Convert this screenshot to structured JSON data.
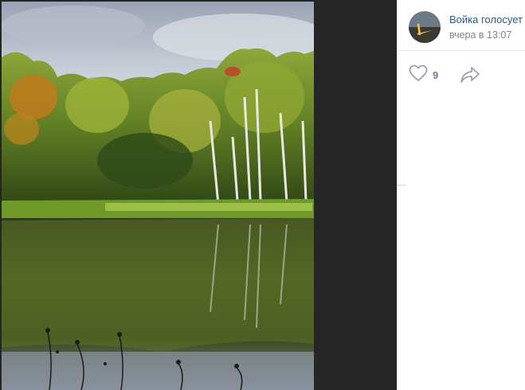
{
  "post": {
    "author": "Войка голосует",
    "time": "вчера в 13:07"
  },
  "actions": {
    "likes": "9",
    "like_icon": "heart-outline-icon",
    "share_icon": "share-arrow-icon"
  },
  "colors": {
    "page_background": "#222222",
    "panel_background": "#ffffff",
    "author_link": "#2a5885",
    "meta_text": "#828282",
    "action_icon": "#99a2ad",
    "count_text": "#6f7c8c"
  }
}
